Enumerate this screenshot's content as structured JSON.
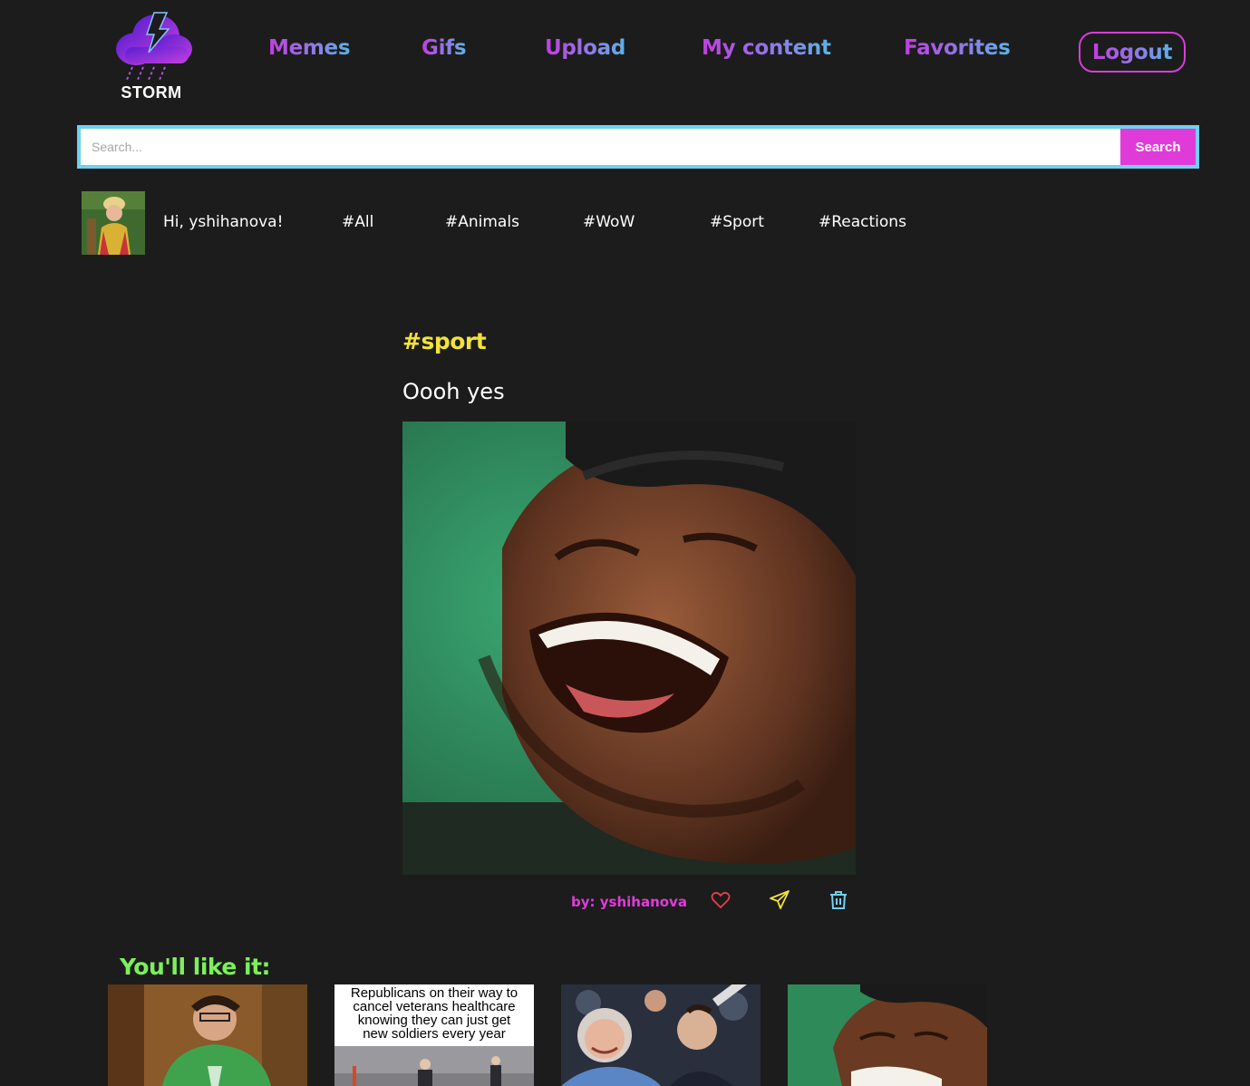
{
  "brand": {
    "name": "STORM"
  },
  "nav": {
    "memes": "Memes",
    "gifs": "Gifs",
    "upload": "Upload",
    "my_content": "My content",
    "favorites": "Favorites",
    "logout": "Logout"
  },
  "search": {
    "placeholder": "Search...",
    "button": "Search"
  },
  "user": {
    "greeting": "Hi, yshihanova!"
  },
  "tags": {
    "all": "#All",
    "animals": "#Animals",
    "wow": "#WoW",
    "sport": "#Sport",
    "reactions": "#Reactions"
  },
  "post": {
    "tag": "#sport",
    "title": "Oooh yes",
    "author": "by: yshihanova",
    "icons": {
      "like": "heart-icon",
      "share": "send-icon",
      "delete": "trash-icon"
    }
  },
  "suggestions": {
    "title": "You'll like it:",
    "items": [
      {
        "caption": ""
      },
      {
        "caption": "Republicans on their way to cancel veterans healthcare knowing they can just get new soldiers every year"
      },
      {
        "caption": ""
      },
      {
        "caption": ""
      }
    ]
  },
  "colors": {
    "background": "#1c1c1d",
    "accent_pink": "#e03bd9",
    "search_border": "#6fd0f0",
    "tag_yellow": "#f2e23a",
    "suggest_green": "#7cf05a"
  }
}
